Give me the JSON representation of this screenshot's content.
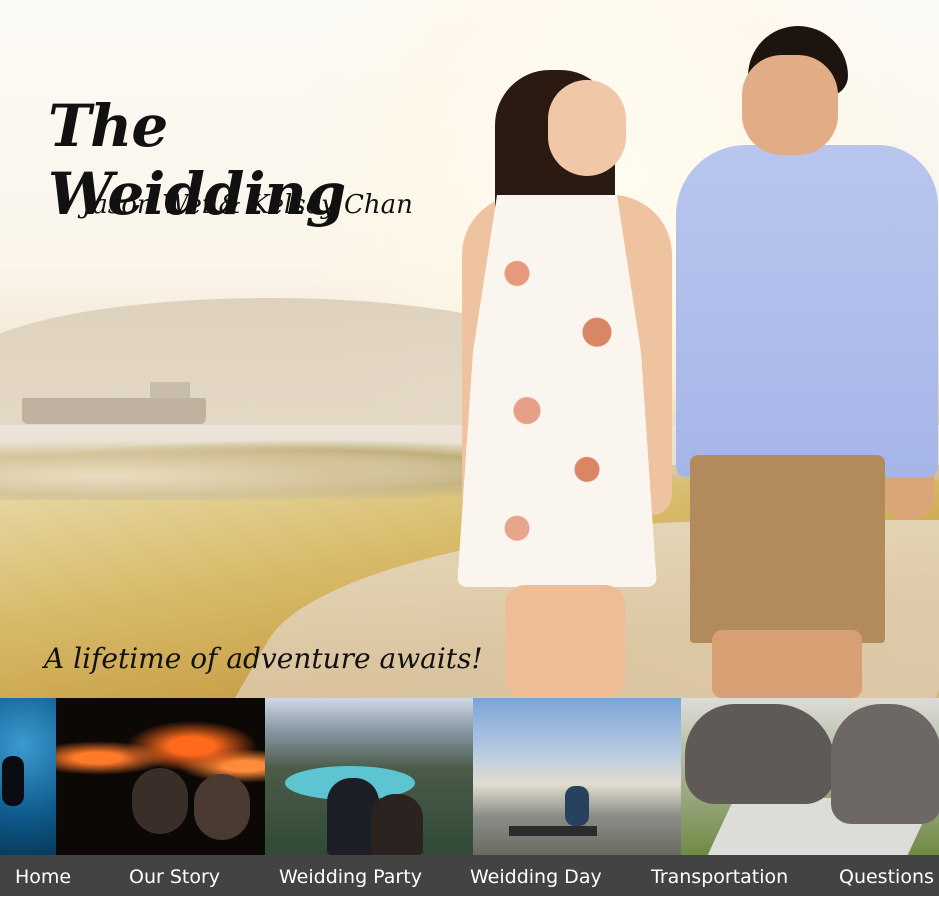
{
  "hero": {
    "title": "The Weidding",
    "subtitle": "Jason Wei & Kelsey Chan",
    "tagline": "A lifetime of adventure awaits!"
  },
  "nav": {
    "items": [
      {
        "label": "Home"
      },
      {
        "label": "Our Story"
      },
      {
        "label": "Weidding Party"
      },
      {
        "label": "Weidding Day"
      },
      {
        "label": "Transportation"
      },
      {
        "label": "Questions"
      }
    ],
    "background": "#434343",
    "text_color": "#ffffff"
  },
  "photo_strip": [
    {
      "subject": "scuba-diver-underwater"
    },
    {
      "subject": "couple-by-lava"
    },
    {
      "subject": "couple-mountain-lake"
    },
    {
      "subject": "city-view-bench"
    },
    {
      "subject": "elephants"
    }
  ]
}
